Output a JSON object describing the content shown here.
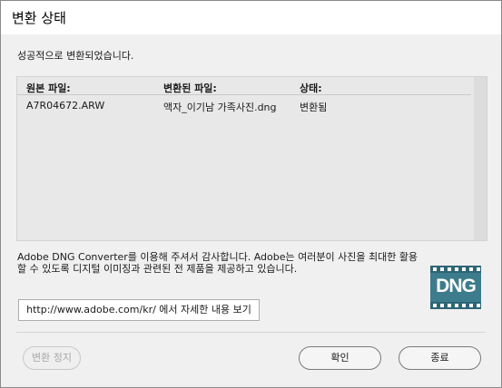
{
  "window": {
    "title": "변환 상태"
  },
  "status_message": "성공적으로 변환되었습니다.",
  "table": {
    "headers": {
      "original": "원본 파일:",
      "converted": "변환된 파일:",
      "state": "상태:"
    },
    "rows": [
      {
        "original": "A7R04672.ARW",
        "converted": "액자_이기남 가족사진.dng",
        "state": "변환됨"
      }
    ]
  },
  "info_text": "Adobe DNG Converter를 이용해 주셔서 감사합니다. Adobe는 여러분이 사진을 최대한 활용할 수 있도록 디지털 이미징과 관련된 전 제품을 제공하고 있습니다.",
  "logo": {
    "text": "DNG",
    "color": "#3c7c8c"
  },
  "link_button": "http://www.adobe.com/kr/ 에서 자세한 내용 보기",
  "buttons": {
    "stop": "변환 정지",
    "ok": "확인",
    "exit": "종료"
  }
}
